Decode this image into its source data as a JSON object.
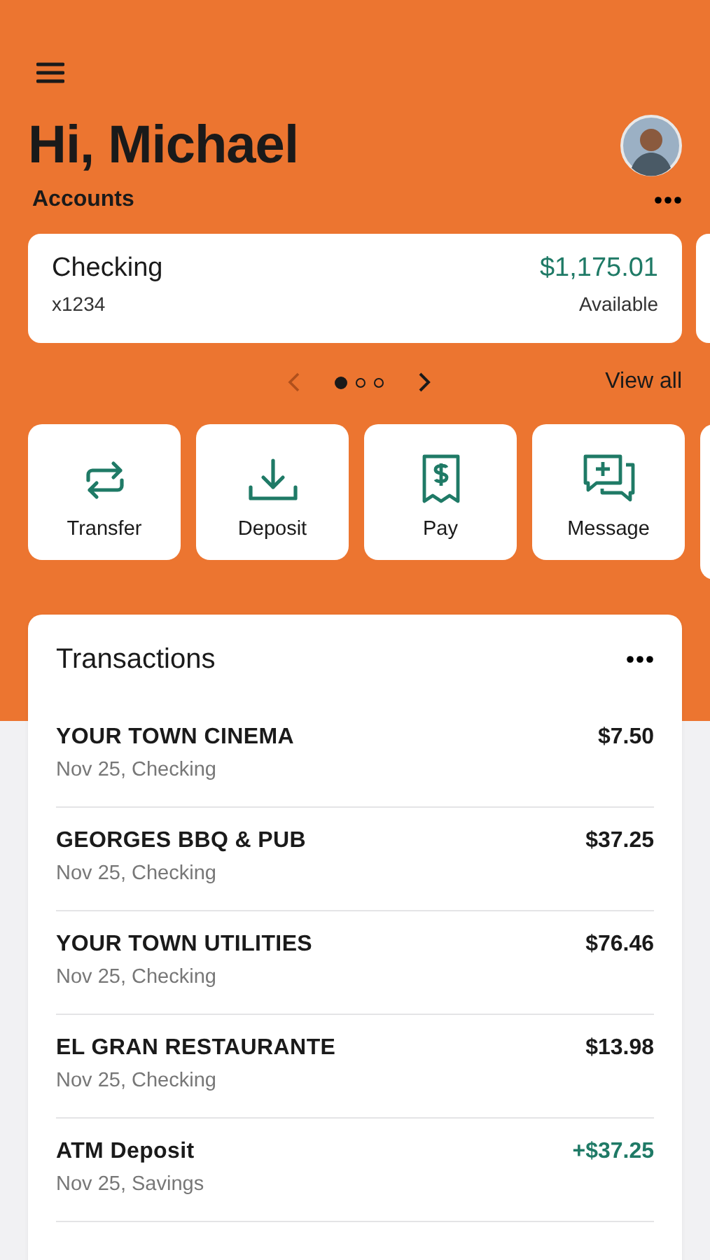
{
  "greeting": "Hi, Michael",
  "accounts": {
    "heading": "Accounts",
    "cards": [
      {
        "name": "Checking",
        "number": "x1234",
        "balance": "$1,175.01",
        "balance_label": "Available"
      }
    ],
    "pager": [
      {
        "selected": true
      },
      {
        "selected": false
      },
      {
        "selected": false
      }
    ],
    "view_all": "View all"
  },
  "actions": [
    {
      "kind": "transfer",
      "label": "Transfer"
    },
    {
      "kind": "deposit",
      "label": "Deposit"
    },
    {
      "kind": "pay",
      "label": "Pay"
    },
    {
      "kind": "message",
      "label": "Message"
    }
  ],
  "transactions": {
    "title": "Transactions",
    "rows": [
      {
        "name": "YOUR TOWN CINEMA",
        "detail": "Nov 25, Checking",
        "amount": "$7.50",
        "kind": "debit"
      },
      {
        "name": "GEORGES BBQ & PUB",
        "detail": "Nov 25, Checking",
        "amount": "$37.25",
        "kind": "debit"
      },
      {
        "name": "YOUR TOWN UTILITIES",
        "detail": "Nov 25, Checking",
        "amount": "$76.46",
        "kind": "debit"
      },
      {
        "name": "EL GRAN RESTAURANTE",
        "detail": "Nov 25, Checking",
        "amount": "$13.98",
        "kind": "debit"
      },
      {
        "name": "ATM Deposit",
        "detail": "Nov 25, Savings",
        "amount": "+$37.25",
        "kind": "credit"
      }
    ]
  }
}
